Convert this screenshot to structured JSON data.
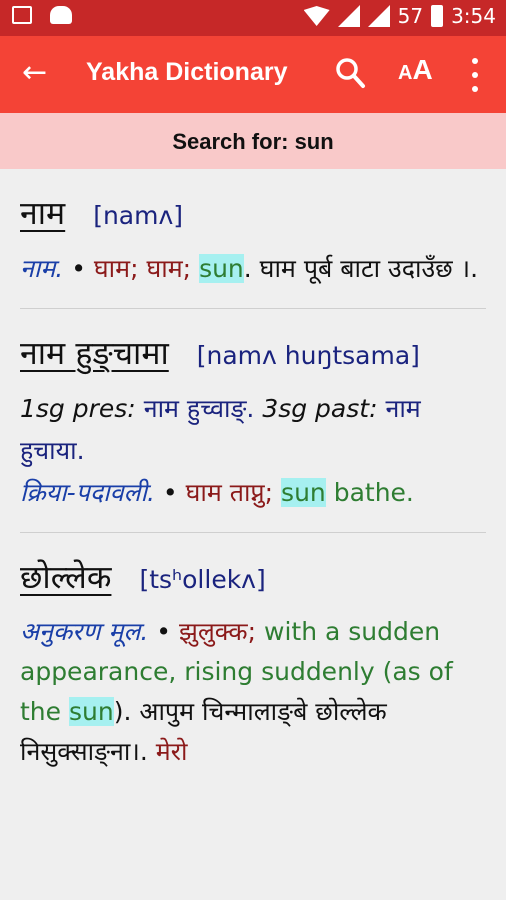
{
  "status_bar": {
    "battery": "57",
    "time": "3:54"
  },
  "toolbar": {
    "title": "Yakha Dictionary",
    "font_size_label_small": "A",
    "font_size_label_big": "A"
  },
  "search_banner": {
    "text": "Search for: sun"
  },
  "entries": [
    {
      "headword": "नाम",
      "ipa": "[namʌ]",
      "lines": [
        {
          "pos": "नाम.",
          "bullet": "•",
          "np1": "घाम;",
          "np2": "घाम;",
          "hl": "sun",
          "rest": ". घाम पूर्ब बाटा उदाउँछ ।."
        }
      ]
    },
    {
      "headword": "नाम हुङ्चामा",
      "ipa": "[namʌ huŋtsama]",
      "gram1_label": "1sg pres:",
      "gram1_value": "नाम हुच्वाङ्.",
      "gram2_label": "3sg past:",
      "gram2_value": "नाम हुचाया.",
      "pos": "क्रिया-पदावली.",
      "bullet": "•",
      "np": "घाम ताप्नु;",
      "hl": "sun",
      "en": "bathe."
    },
    {
      "headword": "छोल्लेक",
      "ipa": "[tsʰollekʌ]",
      "pos": "अनुकरण मूल.",
      "bullet": "•",
      "np": "झुलुक्क;",
      "en1": "with a sudden appearance, rising suddenly (as of the",
      "hl": "sun",
      "en2": ").",
      "example": "आपुम चिन्मालाङ्बे छोल्लेक निसुक्साङ्ना।.",
      "np_tail": "मेरो"
    }
  ]
}
